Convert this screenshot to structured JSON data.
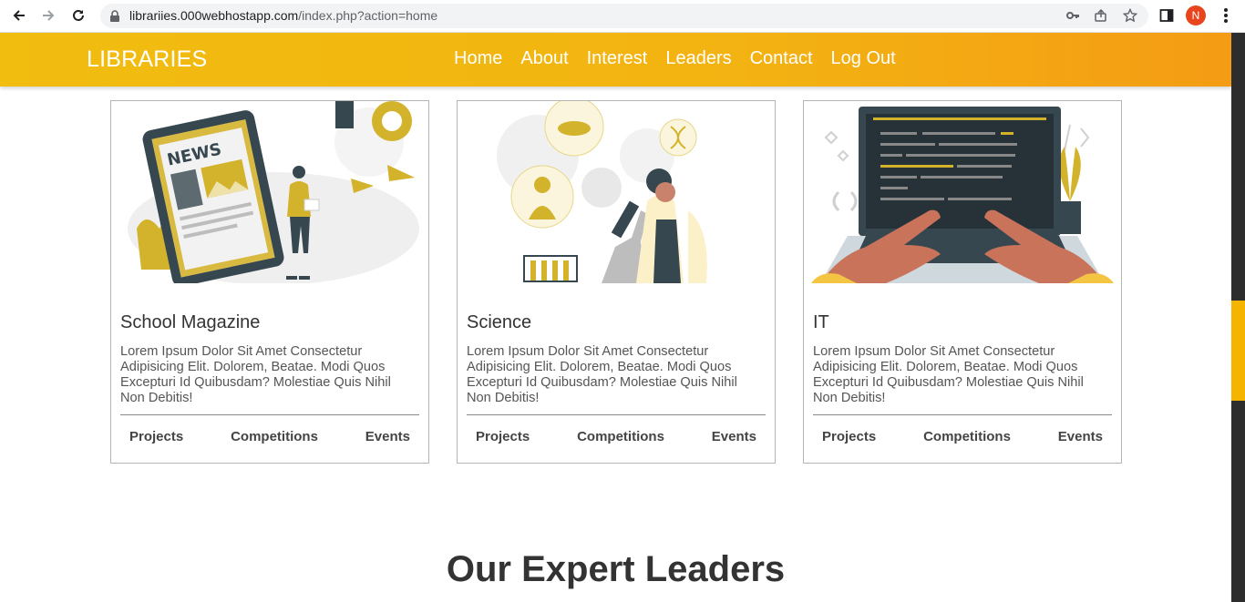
{
  "browser": {
    "url_host": "librariies.000webhostapp.com",
    "url_path": "/index.php?action=home",
    "profile_initial": "N"
  },
  "site": {
    "logo": "LIBRARIES",
    "nav": [
      "Home",
      "About",
      "Interest",
      "Leaders",
      "Contact",
      "Log Out"
    ]
  },
  "cards": [
    {
      "title": "School Magazine",
      "text": "Lorem Ipsum Dolor Sit Amet Consectetur Adipisicing Elit. Dolorem, Beatae. Modi Quos Excepturi Id Quibusdam? Molestiae Quis Nihil Non Debitis!",
      "image_label": "NEWS",
      "links": [
        "Projects",
        "Competitions",
        "Events"
      ]
    },
    {
      "title": "Science",
      "text": "Lorem Ipsum Dolor Sit Amet Consectetur Adipisicing Elit. Dolorem, Beatae. Modi Quos Excepturi Id Quibusdam? Molestiae Quis Nihil Non Debitis!",
      "links": [
        "Projects",
        "Competitions",
        "Events"
      ]
    },
    {
      "title": "IT",
      "text": "Lorem Ipsum Dolor Sit Amet Consectetur Adipisicing Elit. Dolorem, Beatae. Modi Quos Excepturi Id Quibusdam? Molestiae Quis Nihil Non Debitis!",
      "links": [
        "Projects",
        "Competitions",
        "Events"
      ]
    }
  ],
  "section": {
    "title": "Our Expert Leaders"
  },
  "colors": {
    "accent": "#f1bd0f",
    "accent_end": "#f49c14",
    "illustration": "#d4b32c",
    "dark": "#333333"
  }
}
